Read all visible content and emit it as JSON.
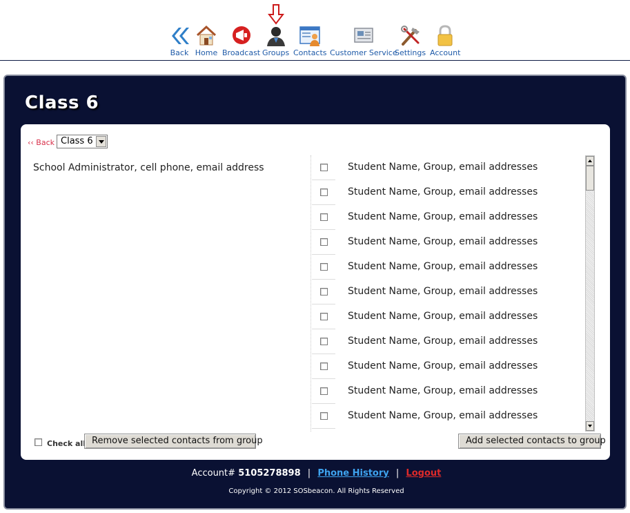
{
  "nav": {
    "items": [
      {
        "label": "Back",
        "icon": "back-chevrons-icon"
      },
      {
        "label": "Home",
        "icon": "home-icon"
      },
      {
        "label": "Broadcast",
        "icon": "megaphone-icon"
      },
      {
        "label": "Groups",
        "icon": "group-person-icon"
      },
      {
        "label": "Contacts",
        "icon": "contacts-card-icon"
      },
      {
        "label": "Customer Service",
        "icon": "envelope-icon"
      },
      {
        "label": "Settings",
        "icon": "tools-icon"
      },
      {
        "label": "Account",
        "icon": "padlock-icon"
      }
    ],
    "active_item": "Groups",
    "indicator_icon": "down-arrow-icon"
  },
  "page": {
    "title": "Class 6",
    "back_label": "‹‹ Back",
    "group_select_value": "Class 6"
  },
  "left_list": {
    "items": [
      "School Administrator, cell phone, email address"
    ]
  },
  "right_list": {
    "items": [
      "Student Name, Group,  email addresses",
      "Student Name, Group,  email addresses",
      "Student Name, Group,  email addresses",
      "Student Name, Group,  email addresses",
      "Student Name, Group,  email addresses",
      "Student Name, Group,  email addresses",
      "Student Name, Group,  email addresses",
      "Student Name, Group,  email addresses",
      "Student Name, Group,  email addresses",
      "Student Name, Group,  email addresses",
      "Student Name, Group,  email addresses"
    ]
  },
  "controls": {
    "check_all_label": "Check all",
    "remove_button": "Remove selected contacts from group",
    "add_button": "Add selected contacts to group"
  },
  "footer": {
    "account_prefix": "Account#",
    "account_number": "5105278898",
    "separator": "|",
    "phone_history": "Phone History",
    "logout": "Logout",
    "copyright": "Copyright © 2012 SOSbeacon. All Rights Reserved"
  },
  "colors": {
    "panel_bg": "#0a1133",
    "nav_label": "#1e5aa8",
    "back_link": "#d8304a",
    "phone_history_link": "#3ea3ef",
    "logout_link": "#e02a2a",
    "indicator_arrow": "#cc1a1a"
  }
}
